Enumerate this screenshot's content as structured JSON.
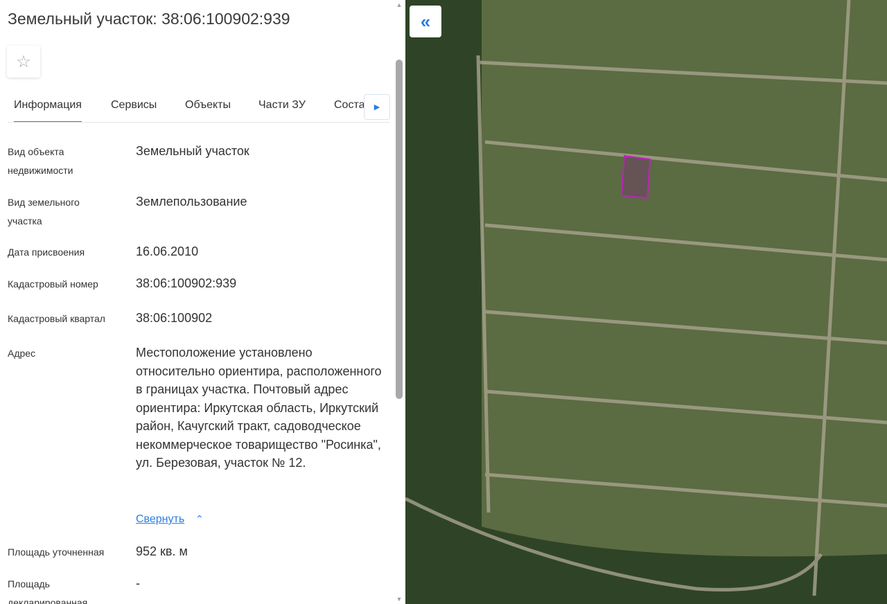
{
  "title": "Земельный участок: 38:06:100902:939",
  "tabs": [
    "Информация",
    "Сервисы",
    "Объекты",
    "Части ЗУ",
    "Состав"
  ],
  "rows": [
    {
      "label": "Вид объекта недвижимости",
      "value": "Земельный участок"
    },
    {
      "label": "Вид земельного участка",
      "value": "Землепользование"
    },
    {
      "label": "Дата присвоения",
      "value": "16.06.2010"
    },
    {
      "label": "Кадастровый номер",
      "value": "38:06:100902:939"
    },
    {
      "label": "Кадастровый квартал",
      "value": "38:06:100902"
    },
    {
      "label": "Адрес",
      "value": "Местоположение установлено относительно ориентира, расположенного в границах участка. Почтовый адрес ориентира: Иркутская область, Иркутский район, Качугский тракт, садоводческое некоммерческое товарищество \"Росинка\", ул. Березовая, участок № 12."
    },
    {
      "label": "Площадь уточненная",
      "value": "952 кв. м"
    },
    {
      "label": "Площадь декларированная",
      "value": "-"
    }
  ],
  "collapse_link": "Свернуть",
  "colors": {
    "accent": "#2a7de1",
    "parcel": "#c020c0"
  }
}
